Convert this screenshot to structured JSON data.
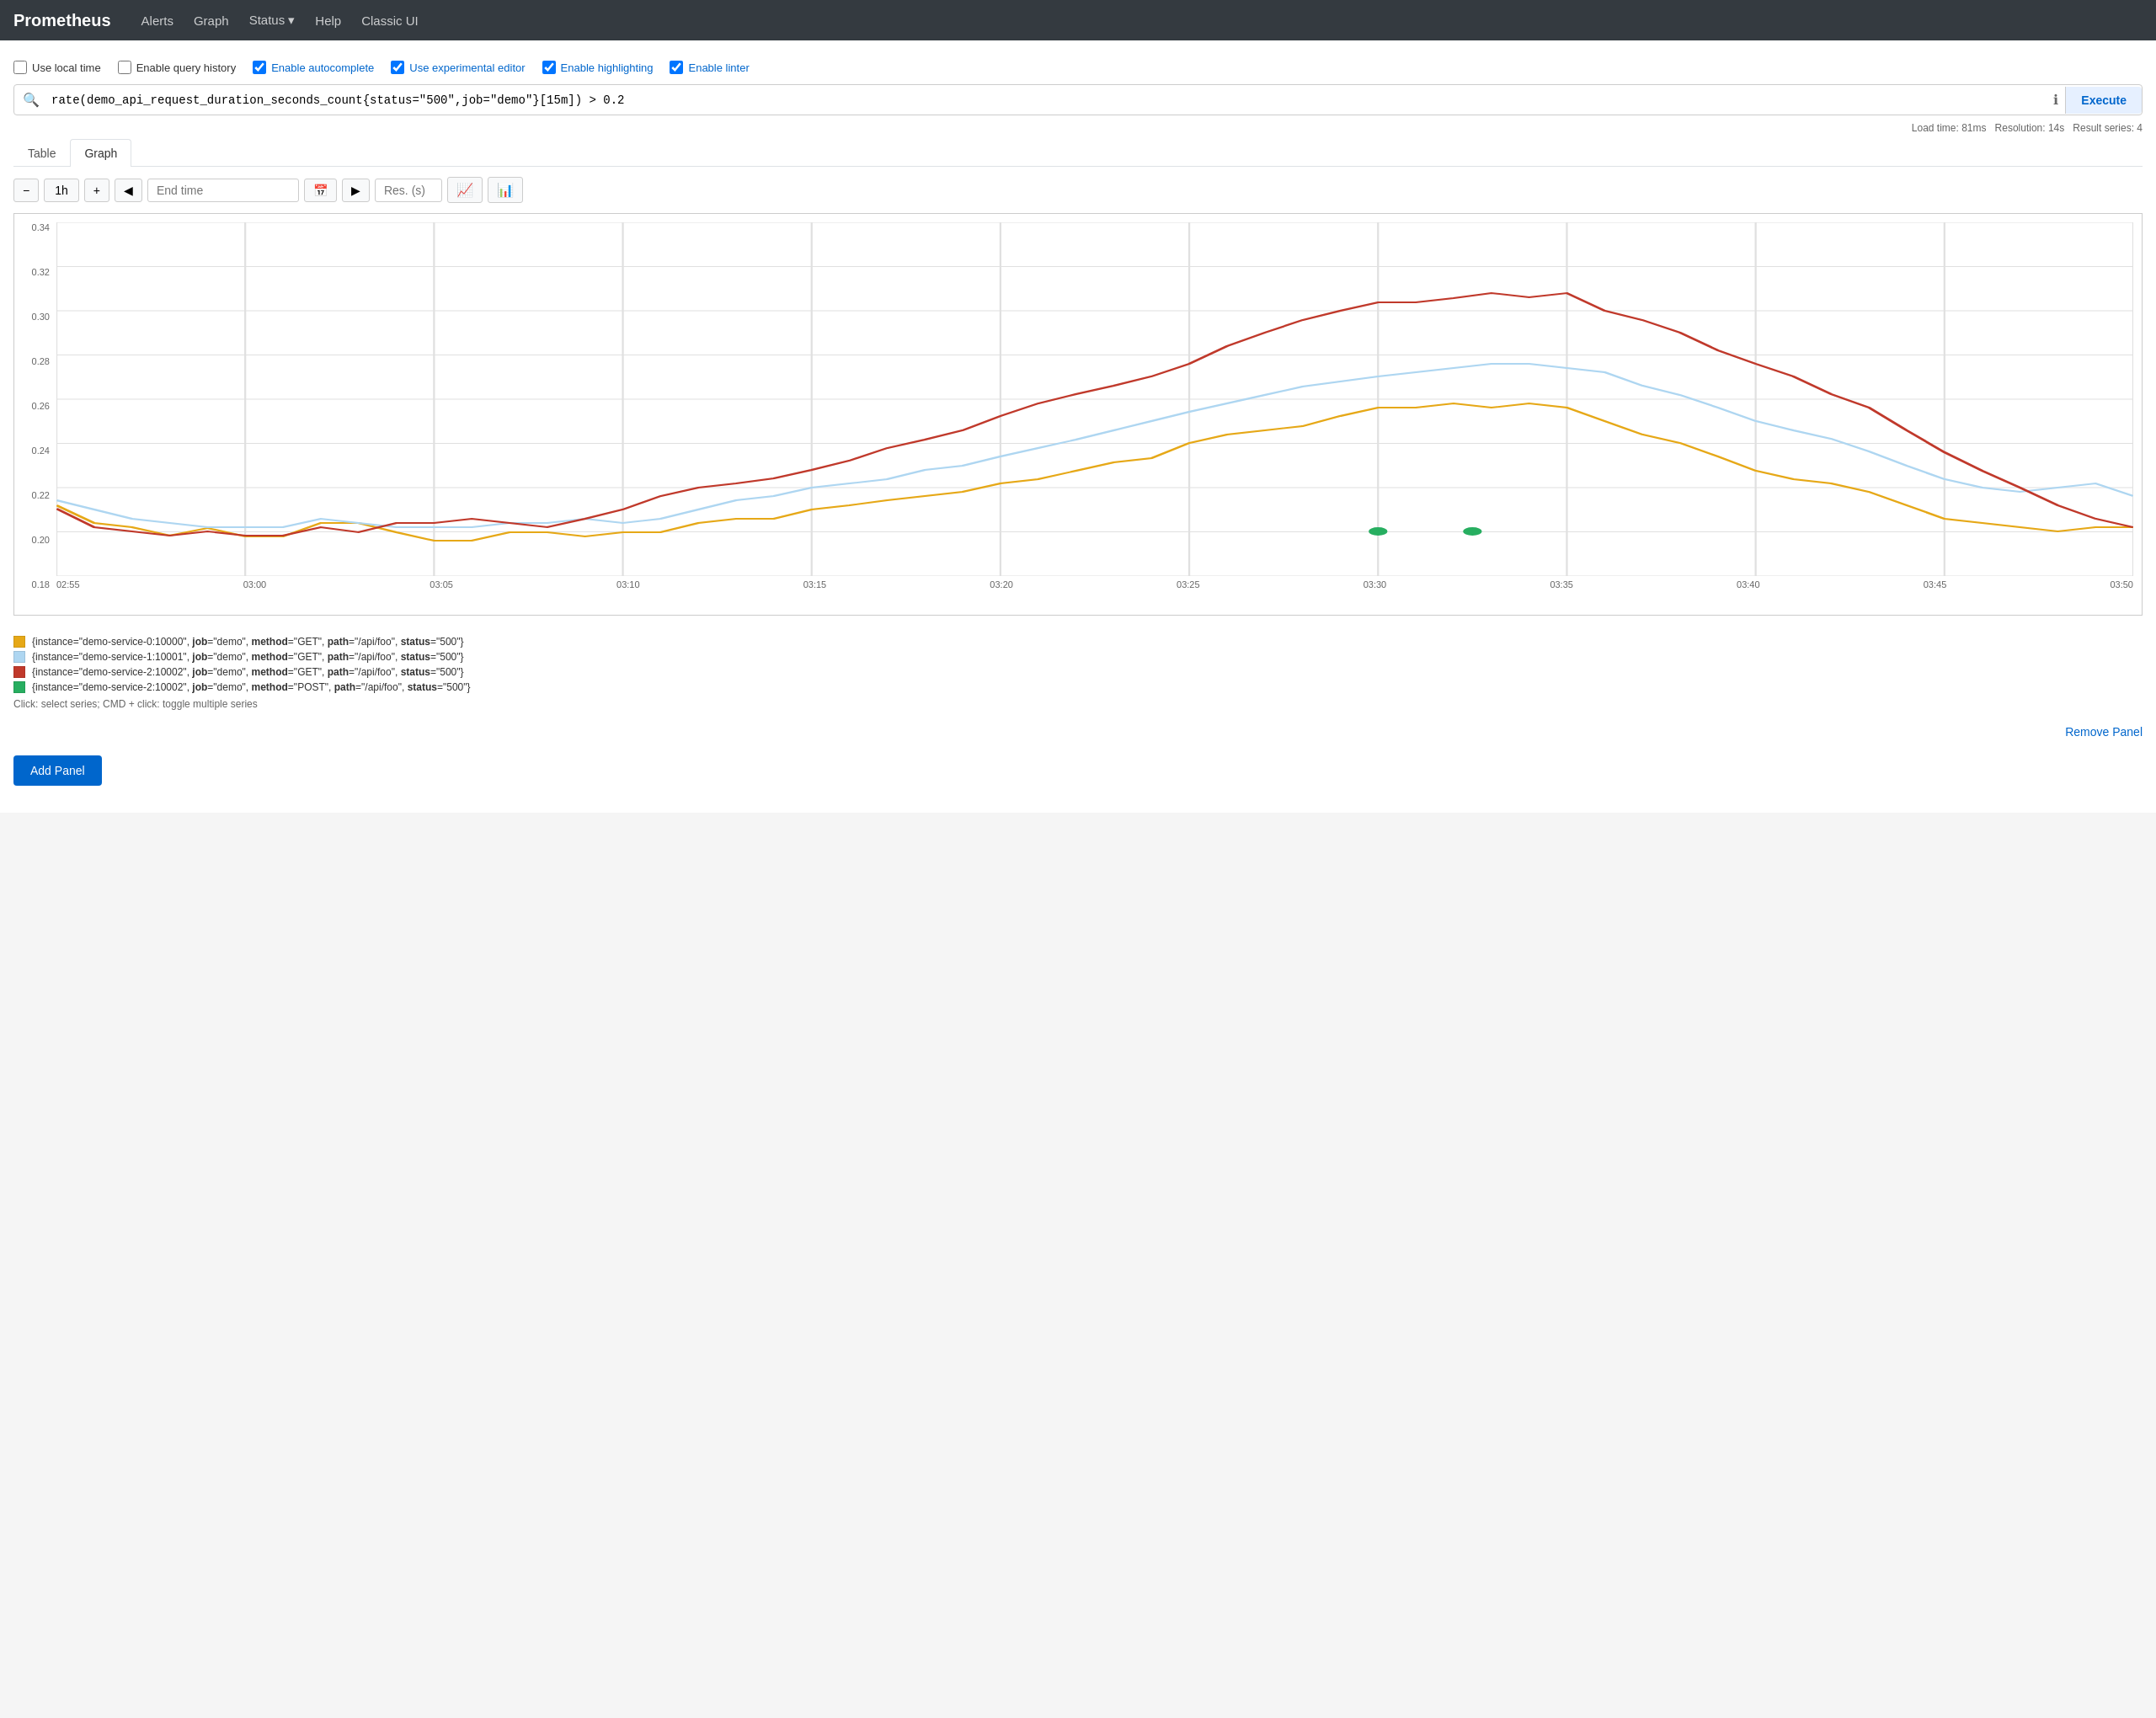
{
  "app": {
    "title": "Prometheus"
  },
  "navbar": {
    "brand": "Prometheus",
    "links": [
      {
        "label": "Alerts",
        "name": "alerts-link"
      },
      {
        "label": "Graph",
        "name": "graph-link"
      },
      {
        "label": "Status",
        "name": "status-link",
        "dropdown": true
      },
      {
        "label": "Help",
        "name": "help-link"
      },
      {
        "label": "Classic UI",
        "name": "classic-ui-link"
      }
    ]
  },
  "options": [
    {
      "label": "Use local time",
      "name": "use-local-time",
      "checked": false
    },
    {
      "label": "Enable query history",
      "name": "enable-query-history",
      "checked": false
    },
    {
      "label": "Enable autocomplete",
      "name": "enable-autocomplete",
      "checked": true,
      "blue": true
    },
    {
      "label": "Use experimental editor",
      "name": "use-experimental-editor",
      "checked": true,
      "blue": true
    },
    {
      "label": "Enable highlighting",
      "name": "enable-highlighting",
      "checked": true,
      "blue": true
    },
    {
      "label": "Enable linter",
      "name": "enable-linter",
      "checked": true,
      "blue": true
    }
  ],
  "query": {
    "value": "rate(demo_api_request_duration_seconds_count{status=\"500\",job=\"demo\"}[15m]) > 0.2",
    "execute_label": "Execute"
  },
  "load_info": {
    "load_time": "Load time: 81ms",
    "resolution": "Resolution: 14s",
    "result_series": "Result series: 4"
  },
  "tabs": [
    {
      "label": "Table",
      "name": "tab-table",
      "active": false
    },
    {
      "label": "Graph",
      "name": "tab-graph",
      "active": true
    }
  ],
  "graph_controls": {
    "minus_label": "−",
    "range_label": "1h",
    "plus_label": "+",
    "prev_label": "◀",
    "next_label": "▶",
    "endtime_placeholder": "End time",
    "res_placeholder": "Res. (s)"
  },
  "chart": {
    "y_labels": [
      "0.34",
      "0.32",
      "0.30",
      "0.28",
      "0.26",
      "0.24",
      "0.22",
      "0.20",
      "0.18"
    ],
    "x_labels": [
      "02:55",
      "03:00",
      "03:05",
      "03:10",
      "03:15",
      "03:20",
      "03:25",
      "03:30",
      "03:35",
      "03:40",
      "03:45",
      "03:50"
    ]
  },
  "legend": {
    "items": [
      {
        "color": "#e6a817",
        "text": "{instance=\"demo-service-0:10000\", job=\"demo\", method=\"GET\", path=\"/api/foo\", status=\"500\"}"
      },
      {
        "color": "#aed6f1",
        "text": "{instance=\"demo-service-1:10001\", job=\"demo\", method=\"GET\", path=\"/api/foo\", status=\"500\"}"
      },
      {
        "color": "#c0392b",
        "text": "{instance=\"demo-service-2:10002\", job=\"demo\", method=\"GET\", path=\"/api/foo\", status=\"500\"}"
      },
      {
        "color": "#27ae60",
        "text": "{instance=\"demo-service-2:10002\", job=\"demo\", method=\"POST\", path=\"/api/foo\", status=\"500\"}"
      }
    ],
    "hint": "Click: select series; CMD + click: toggle multiple series"
  },
  "remove_panel_label": "Remove Panel",
  "add_panel_label": "Add Panel"
}
